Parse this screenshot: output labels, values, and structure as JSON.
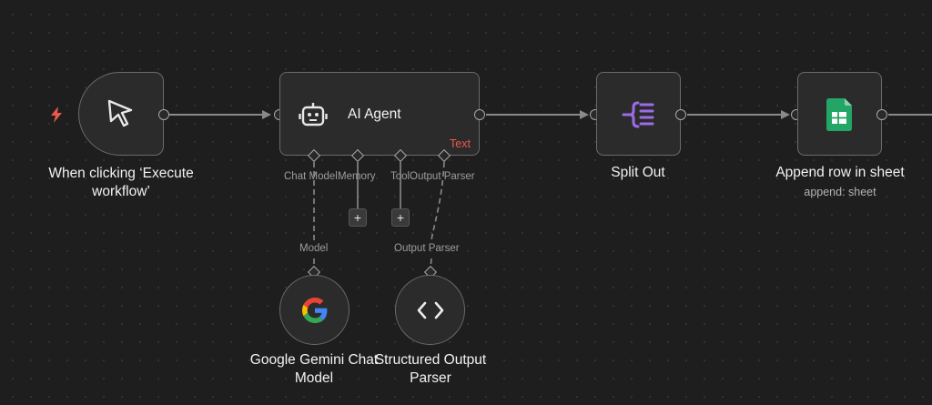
{
  "canvas": {
    "background": "#1f1e1e",
    "accent_red": "#ea5a4a"
  },
  "nodes": {
    "trigger": {
      "title": "When clicking ‘Execute workflow’",
      "icon": "cursor-arrow-icon",
      "badge_icon": "lightning-bolt-icon"
    },
    "agent": {
      "title": "AI Agent",
      "badge": "Text",
      "icon": "robot-icon"
    },
    "split": {
      "title": "Split Out",
      "icon": "split-out-icon",
      "icon_color": "#9b6ce8"
    },
    "sheets": {
      "title": "Append row in sheet",
      "subtitle": "append: sheet",
      "icon": "google-sheets-icon",
      "icon_color": "#23a566"
    },
    "gemini": {
      "title": "Google Gemini Chat Model",
      "icon": "google-g-icon"
    },
    "parser": {
      "title": "Structured Output Parser",
      "icon": "code-brackets-icon"
    }
  },
  "agent_inputs": {
    "chat_model": "Chat Model",
    "memory": "Memory",
    "tool": "Tool",
    "output_parser": "Output Parser"
  },
  "connection_labels": {
    "model": "Model",
    "output_parser": "Output Parser"
  },
  "buttons": {
    "add_symbol": "+"
  }
}
